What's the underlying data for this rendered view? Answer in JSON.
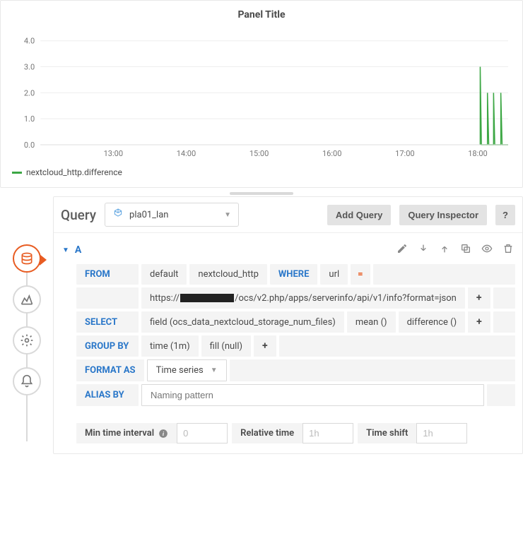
{
  "panel": {
    "title": "Panel Title"
  },
  "chart_data": {
    "type": "line",
    "categories": [
      "13:00",
      "14:00",
      "15:00",
      "16:00",
      "17:00",
      "18:00"
    ],
    "y_ticks": [
      0,
      1.0,
      2.0,
      3.0,
      4.0
    ],
    "ylim": [
      0,
      4.4
    ],
    "series": [
      {
        "name": "nextcloud_http.difference",
        "color": "#3ca744",
        "points": [
          {
            "x": "18:02",
            "y": 0
          },
          {
            "x": "18:02",
            "y": 3.0
          },
          {
            "x": "18:03",
            "y": 0
          },
          {
            "x": "18:08",
            "y": 0
          },
          {
            "x": "18:08",
            "y": 2.0
          },
          {
            "x": "18:09",
            "y": 0
          },
          {
            "x": "18:13",
            "y": 0
          },
          {
            "x": "18:13",
            "y": 2.0
          },
          {
            "x": "18:14",
            "y": 0
          },
          {
            "x": "18:19",
            "y": 0
          },
          {
            "x": "18:19",
            "y": 2.0
          },
          {
            "x": "18:20",
            "y": 0
          },
          {
            "x": "18:25",
            "y": 0
          }
        ]
      }
    ],
    "x_range_minutes": [
      720,
      1105
    ]
  },
  "legend": {
    "series0": "nextcloud_http.difference"
  },
  "query": {
    "heading": "Query",
    "datasource": "pla01_lan",
    "addQueryBtn": "Add Query",
    "inspectorBtn": "Query Inspector",
    "helpBtn": "?",
    "row_letter": "A",
    "from_label": "FROM",
    "from_default": "default",
    "from_measurement": "nextcloud_http",
    "where_kw": "WHERE",
    "where_field": "url",
    "where_op": "=",
    "where_value_prefix": "https://",
    "where_value_suffix": "/ocs/v2.php/apps/serverinfo/api/v1/info?format=json",
    "plus": "+",
    "select_label": "SELECT",
    "select_field": "field (ocs_data_nextcloud_storage_num_files)",
    "select_mean": "mean ()",
    "select_diff": "difference ()",
    "groupby_label": "GROUP BY",
    "groupby_time": "time (1m)",
    "groupby_fill": "fill (null)",
    "formatas_label": "FORMAT AS",
    "formatas_value": "Time series",
    "aliasby_label": "ALIAS BY",
    "aliasby_placeholder": "Naming pattern",
    "min_interval_label": "Min time interval",
    "min_interval_placeholder": "0",
    "rel_time_label": "Relative time",
    "rel_time_placeholder": "1h",
    "time_shift_label": "Time shift",
    "time_shift_placeholder": "1h"
  }
}
